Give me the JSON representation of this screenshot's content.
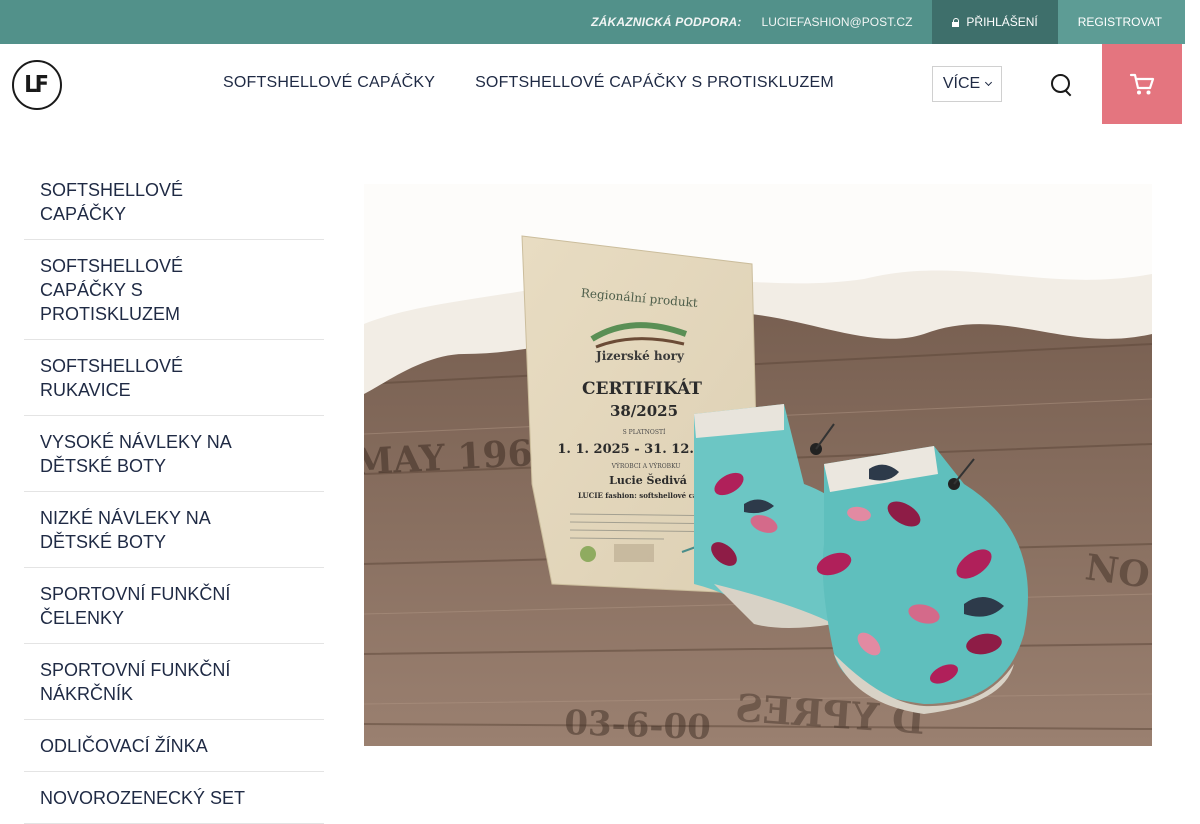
{
  "topbar": {
    "support_label": "ZÁKAZNICKÁ PODPORA:",
    "email": "LUCIEFASHION@POST.CZ",
    "login_label": "PŘIHLÁŠENÍ",
    "register_label": "REGISTROVAT"
  },
  "header": {
    "logo_text": "LF",
    "nav": [
      "SOFTSHELLOVÉ CAPÁČKY",
      "SOFTSHELLOVÉ CAPÁČKY S PROTISKLUZEM"
    ],
    "more_label": "VÍCE"
  },
  "sidebar": {
    "categories": [
      "SOFTSHELLOVÉ CAPÁČKY",
      "SOFTSHELLOVÉ CAPÁČKY S PROTISKLUZEM",
      "SOFTSHELLOVÉ RUKAVICE",
      "VYSOKÉ NÁVLEKY NA DĚTSKÉ BOTY",
      "NIZKÉ NÁVLEKY NA DĚTSKÉ BOTY",
      "SPORTOVNÍ FUNKČNÍ ČELENKY",
      "SPORTOVNÍ FUNKČNÍ NÁKRČNÍK",
      "ODLIČOVACÍ ŽÍNKA",
      "NOVOROZENECKÝ SET"
    ]
  },
  "banner": {
    "cert_title_1": "Regionální produkt",
    "cert_region": "Jizerské hory",
    "cert_heading": "CERTIFIKÁT",
    "cert_number": "38/2025",
    "cert_validity_label": "S PLATNOSTÍ",
    "cert_dates": "1. 1. 2025 - 31. 12. 2026",
    "cert_issued_label": "VÝROBCI A VÝROBKU",
    "cert_producer": "Lucie Šedivá",
    "cert_product": "LUCIE fashion: softshellové capáčky",
    "floor_text_1": "MAY 196",
    "floor_text_2": "D YPRES",
    "floor_text_3": "03-6-00",
    "floor_text_4": "NO",
    "colors": {
      "topbar": "#52918a",
      "login_bg": "#3e6f6b",
      "cart_bg": "#e4757f",
      "bootie_fabric": "#6cc6c4",
      "leaf_accent": "#b0205a"
    }
  }
}
